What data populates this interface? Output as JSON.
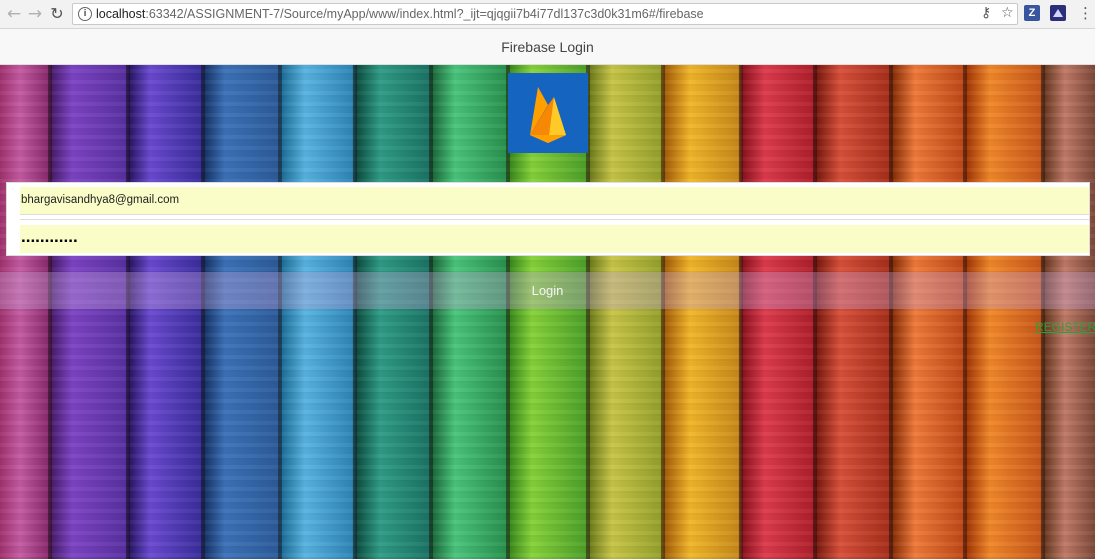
{
  "browser": {
    "back_glyph": "←",
    "forward_glyph": "→",
    "reload_glyph": "↻",
    "info_glyph": "i",
    "url_host": "localhost",
    "url_rest": ":63342/ASSIGNMENT-7/Source/myApp/www/index.html?_ijt=qjqgii7b4i77dl137c3d0k31m6#/firebase",
    "key_glyph": "⚷",
    "star_glyph": "☆",
    "ext1_label": "Z",
    "ext2_label": "",
    "menu_glyph": "⋮",
    "icons": [
      "back-icon",
      "forward-icon",
      "reload-icon",
      "info-icon",
      "key-icon",
      "star-icon",
      "extension-z-icon",
      "extension-icon",
      "menu-icon"
    ]
  },
  "header": {
    "title": "Firebase Login"
  },
  "form": {
    "email_value": "bhargavisandhya8@gmail.com",
    "password_mask": "............",
    "login_label": "Login",
    "register_label": "REGISTER"
  },
  "colors": {
    "logo_bg": "#1565c0",
    "field_bg": "#fafdc8",
    "register_link": "#2e9e3a"
  }
}
